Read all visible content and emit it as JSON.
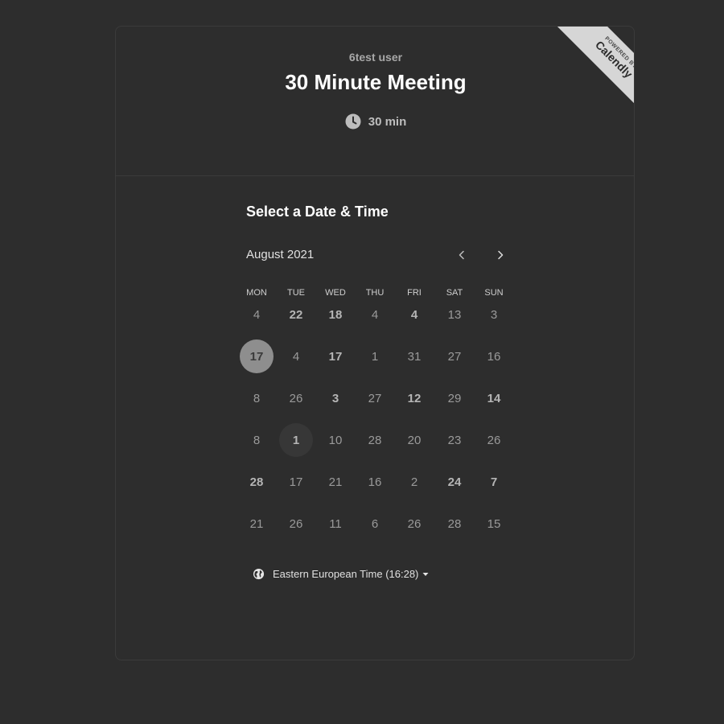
{
  "header": {
    "host_name": "6test user",
    "event_title": "30 Minute Meeting",
    "duration": "30 min"
  },
  "badge": {
    "powered_by": "POWERED BY",
    "brand": "Calendly"
  },
  "scheduler": {
    "section_title": "Select a Date & Time",
    "month_label": "August 2021",
    "weekdays": [
      "MON",
      "TUE",
      "WED",
      "THU",
      "FRI",
      "SAT",
      "SUN"
    ],
    "weeks": [
      [
        "4",
        "22",
        "18",
        "4",
        "4",
        "13",
        "3"
      ],
      [
        "17",
        "4",
        "17",
        "1",
        "31",
        "27",
        "16"
      ],
      [
        "8",
        "26",
        "3",
        "27",
        "12",
        "29",
        "14"
      ],
      [
        "8",
        "1",
        "10",
        "28",
        "20",
        "23",
        "26"
      ],
      [
        "28",
        "17",
        "21",
        "16",
        "2",
        "24",
        "7"
      ],
      [
        "21",
        "26",
        "11",
        "6",
        "26",
        "28",
        "15"
      ]
    ],
    "available": [
      [
        false,
        true,
        true,
        false,
        true,
        false,
        false
      ],
      [
        true,
        false,
        true,
        false,
        false,
        false,
        false
      ],
      [
        false,
        false,
        true,
        false,
        true,
        false,
        true
      ],
      [
        false,
        true,
        false,
        false,
        false,
        false,
        false
      ],
      [
        true,
        false,
        false,
        false,
        false,
        true,
        true
      ],
      [
        false,
        false,
        false,
        false,
        false,
        false,
        false
      ]
    ],
    "selected": [
      1,
      0
    ],
    "today": [
      3,
      1
    ],
    "timezone": "Eastern European Time (16:28)"
  },
  "icons": {
    "duration": "clock-icon",
    "timezone": "globe-icon",
    "prev": "chevron-left-icon",
    "next": "chevron-right-icon",
    "dropdown": "caret-down-icon"
  }
}
